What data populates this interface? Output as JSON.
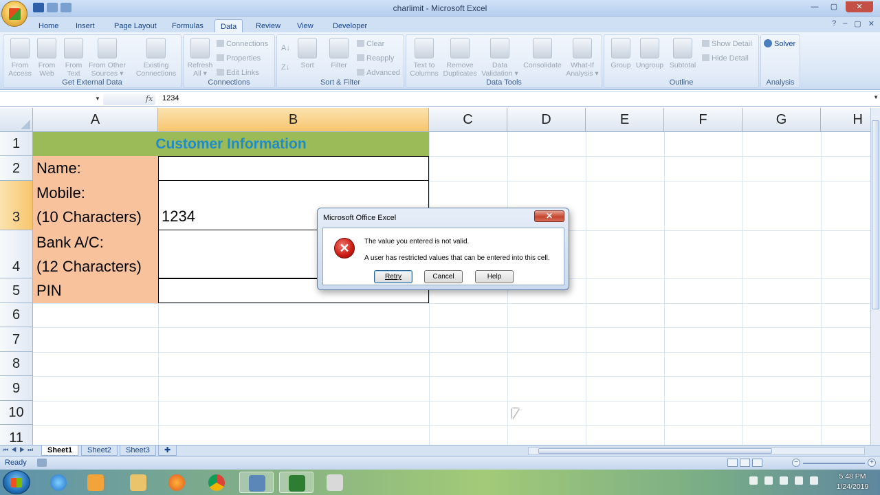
{
  "window": {
    "title": "charlimit - Microsoft Excel",
    "controls": {
      "minimize": "—",
      "maximize": "▢",
      "close": "✕"
    }
  },
  "tabs": [
    "Home",
    "Insert",
    "Page Layout",
    "Formulas",
    "Data",
    "Review",
    "View",
    "Developer"
  ],
  "active_tab": "Data",
  "ribbon": {
    "get_external_data": {
      "label": "Get External Data",
      "buttons": [
        {
          "line1": "From",
          "line2": "Access"
        },
        {
          "line1": "From",
          "line2": "Web"
        },
        {
          "line1": "From",
          "line2": "Text"
        },
        {
          "line1": "From Other",
          "line2": "Sources ▾"
        },
        {
          "line1": "Existing",
          "line2": "Connections"
        }
      ]
    },
    "connections": {
      "label": "Connections",
      "refresh": {
        "line1": "Refresh",
        "line2": "All ▾"
      },
      "small": [
        "Connections",
        "Properties",
        "Edit Links"
      ]
    },
    "sort_filter": {
      "label": "Sort & Filter",
      "sort": "Sort",
      "filter": "Filter",
      "small": [
        "Clear",
        "Reapply",
        "Advanced"
      ]
    },
    "data_tools": {
      "label": "Data Tools",
      "buttons": [
        {
          "line1": "Text to",
          "line2": "Columns"
        },
        {
          "line1": "Remove",
          "line2": "Duplicates"
        },
        {
          "line1": "Data",
          "line2": "Validation ▾"
        },
        {
          "line1": "Consolidate",
          "line2": ""
        },
        {
          "line1": "What-If",
          "line2": "Analysis ▾"
        }
      ]
    },
    "outline": {
      "label": "Outline",
      "buttons": [
        "Group",
        "Ungroup",
        "Subtotal"
      ],
      "small": [
        "Show Detail",
        "Hide Detail"
      ]
    },
    "analysis": {
      "label": "Analysis",
      "solver": "Solver"
    }
  },
  "formula_bar": {
    "fx": "fx",
    "value": "1234"
  },
  "columns": [
    "A",
    "B",
    "C",
    "D",
    "E",
    "F",
    "G",
    "H"
  ],
  "rows": [
    "1",
    "2",
    "3",
    "4",
    "5",
    "6",
    "7",
    "8",
    "9",
    "10",
    "11"
  ],
  "cells": {
    "title": "Customer Information",
    "name_label": "Name:",
    "mobile_label_1": "Mobile:",
    "mobile_label_2": "(10 Characters)",
    "mobile_value": "1234",
    "bank_label_1": "Bank A/C:",
    "bank_label_2": "(12 Characters)",
    "pin_label": "PIN"
  },
  "colors": {
    "title_fill": "#9bbb59",
    "title_text": "#1f8bc9",
    "label_fill": "#f8c39c",
    "selected_header": "#f7c56d"
  },
  "dialog": {
    "title": "Microsoft Office Excel",
    "icon": "error-icon",
    "message_1": "The value you entered is not valid.",
    "message_2": "A user has restricted values that can be entered into this cell.",
    "buttons": [
      "Retry",
      "Cancel",
      "Help"
    ]
  },
  "sheets": [
    "Sheet1",
    "Sheet2",
    "Sheet3"
  ],
  "active_sheet": "Sheet1",
  "status": {
    "ready": "Ready"
  },
  "taskbar": {
    "time": "5:48 PM",
    "date": "1/24/2019"
  }
}
